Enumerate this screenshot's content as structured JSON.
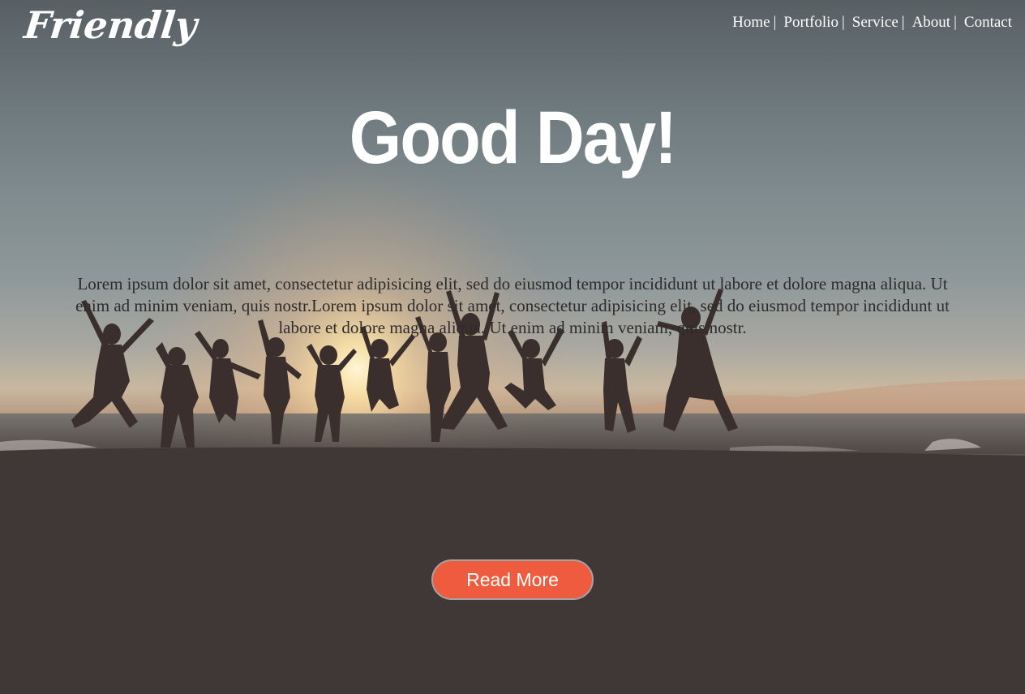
{
  "brand": {
    "logo_text": "Friendly"
  },
  "nav": {
    "items": [
      {
        "label": "Home"
      },
      {
        "label": "Portfolio"
      },
      {
        "label": "Service"
      },
      {
        "label": "About"
      },
      {
        "label": "Contact"
      }
    ],
    "separator": "|"
  },
  "hero": {
    "headline": "Good Day!",
    "intro": "Lorem ipsum dolor sit amet, consectetur adipisicing elit, sed do eiusmod tempor incididunt ut labore et dolore magna aliqua. Ut enim ad minim veniam, quis nostr.Lorem ipsum dolor sit amet, consectetur adipisicing elit, sed do eiusmod tempor incididunt ut labore et dolore magna aliqua. Ut enim ad minim veniam, quis nostr.",
    "cta_label": "Read More"
  },
  "colors": {
    "cta_background": "#ee5b3e",
    "text_light": "#ffffff",
    "intro_text": "#2d2b2b"
  }
}
